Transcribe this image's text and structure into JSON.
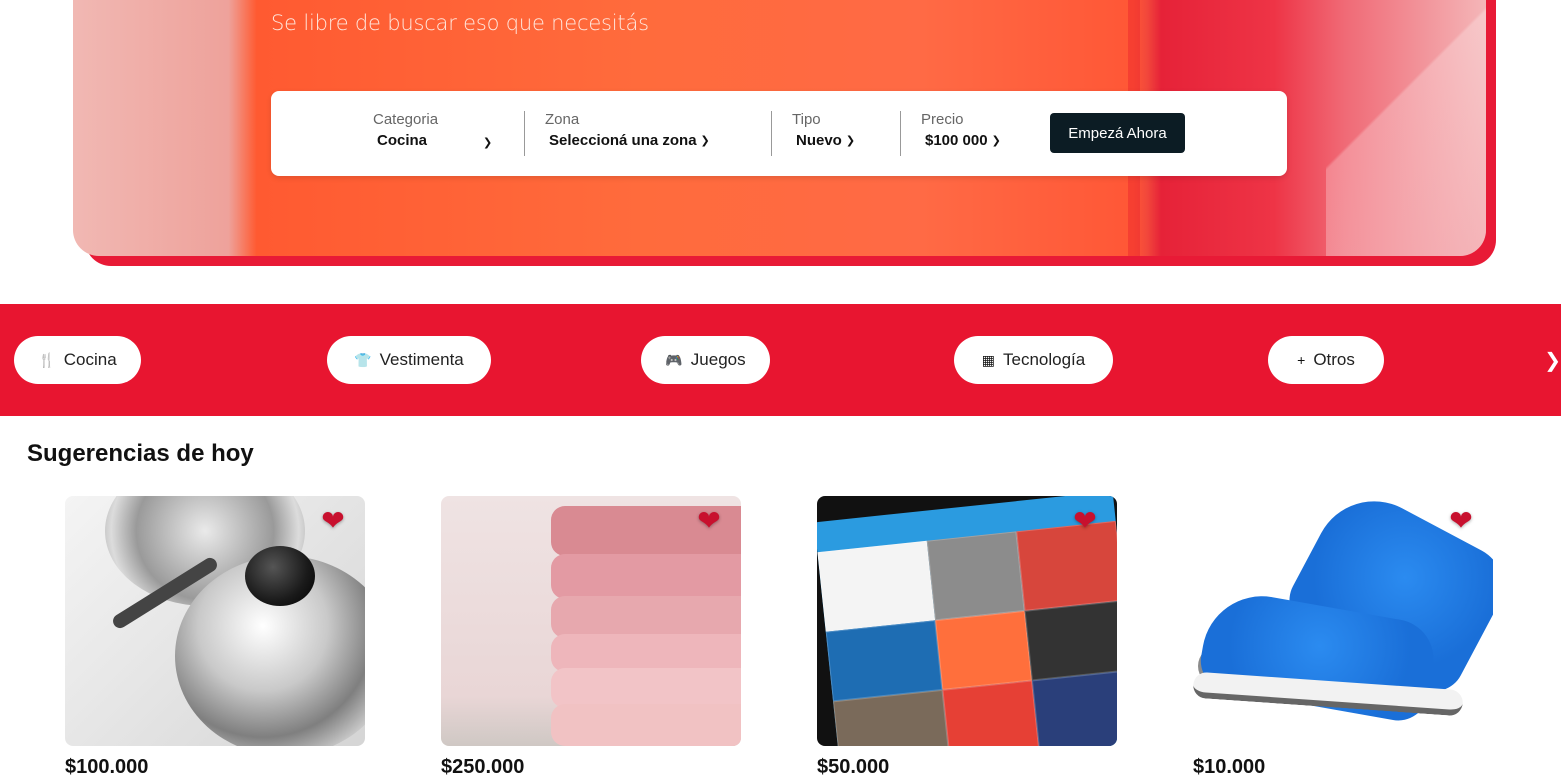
{
  "hero": {
    "subtitle": "Se libre de buscar eso que necesitás",
    "colors": {
      "accent": "#e81530",
      "cta_bg": "#0c1c24"
    }
  },
  "search": {
    "categoria": {
      "label": "Categoria",
      "value": "Cocina"
    },
    "zona": {
      "label": "Zona",
      "value": "Seleccioná una zona"
    },
    "tipo": {
      "label": "Tipo",
      "value": "Nuevo"
    },
    "precio": {
      "label": "Precio",
      "value": "$100 000"
    },
    "cta": "Empezá Ahora"
  },
  "categories": [
    {
      "label": "Cocina",
      "icon": "utensils-icon"
    },
    {
      "label": "Vestimenta",
      "icon": "tshirt-icon"
    },
    {
      "label": "Juegos",
      "icon": "gamepad-icon"
    },
    {
      "label": "Tecnología",
      "icon": "chip-icon"
    },
    {
      "label": "Otros",
      "icon": "plus-icon"
    }
  ],
  "suggestions": {
    "title": "Sugerencias de hoy",
    "items": [
      {
        "price": "$100.000",
        "image": "cookware-pot",
        "favorite": true
      },
      {
        "price": "$250.000",
        "image": "pink-sweaters",
        "favorite": true
      },
      {
        "price": "$50.000",
        "image": "tablet-app",
        "favorite": true
      },
      {
        "price": "$10.000",
        "image": "blue-sneakers",
        "favorite": true
      }
    ]
  }
}
